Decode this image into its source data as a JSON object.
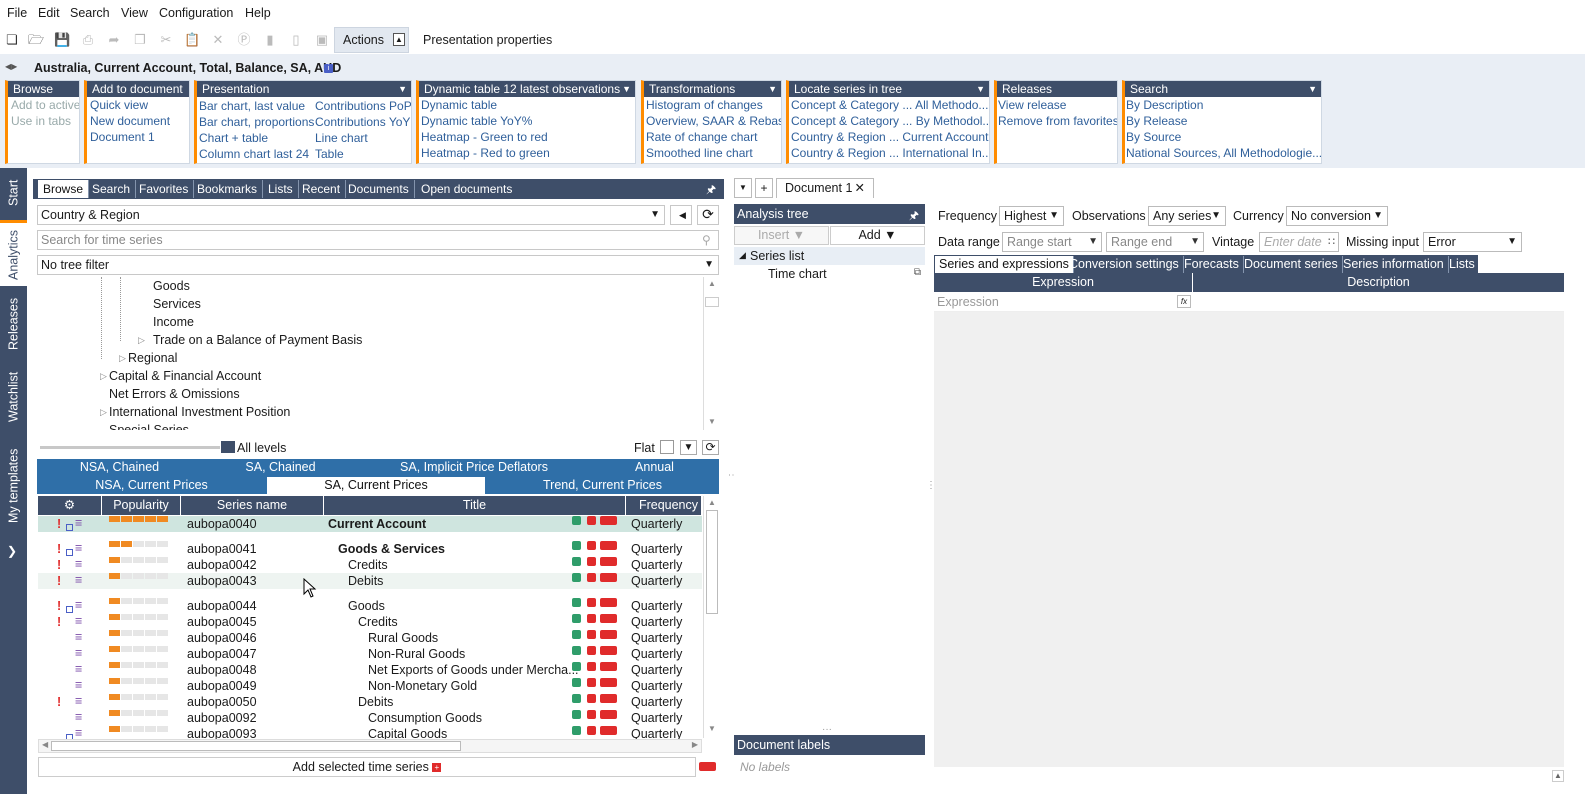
{
  "menu": [
    "File",
    "Edit",
    "Search",
    "View",
    "Configuration",
    "Help"
  ],
  "toolbar": {
    "actions_tab": "Actions",
    "presentation_tab": "Presentation properties"
  },
  "series_title": "Australia, Current Account, Total, Balance, SA, AUD",
  "ribbon": {
    "browse": {
      "title": "Browse",
      "items": [
        "Add to active",
        "Use in tabs"
      ]
    },
    "add_to_document": {
      "title": "Add to document",
      "items": [
        "Quick view",
        "New document",
        "Document 1"
      ]
    },
    "presentation": {
      "title": "Presentation",
      "col1": [
        "Bar chart, last value",
        "Bar chart, proportions",
        "Chart + table",
        "Column chart last 24"
      ],
      "col2": [
        "Contributions PoP",
        "Contributions YoY",
        "Line chart",
        "Table"
      ]
    },
    "dynamic_table": {
      "title": "Dynamic table 12 latest observations",
      "items": [
        "Dynamic table",
        "Dynamic table YoY%",
        "Heatmap - Green to red",
        "Heatmap - Red to green"
      ]
    },
    "transformations": {
      "title": "Transformations",
      "items": [
        "Histogram of changes",
        "Overview, SAAR & Rebase",
        "Rate of change chart",
        "Smoothed line chart"
      ]
    },
    "locate": {
      "title": "Locate series in tree",
      "items": [
        "Concept & Category ... All Methodo...",
        "Concept & Category ... By Methodol...",
        "Country & Region ... Current Account",
        "Country & Region ... International In..."
      ]
    },
    "releases": {
      "title": "Releases",
      "items": [
        "View release",
        "Remove from favorites"
      ]
    },
    "search": {
      "title": "Search",
      "items": [
        "By Description",
        "By Release",
        "By Source",
        "National Sources, All Methodologie..."
      ]
    }
  },
  "sidebar": [
    "Start",
    "Analytics",
    "Releases",
    "Watchlist",
    "My templates"
  ],
  "browse_tabs": [
    "Browse",
    "Search",
    "Favorites",
    "Bookmarks",
    "Lists",
    "Recent",
    "Documents",
    "Open documents"
  ],
  "tree_select": "Country & Region",
  "search_placeholder": "Search for time series",
  "tree_filter": "No tree filter",
  "tree": [
    {
      "label": "Goods",
      "indent": 2
    },
    {
      "label": "Services",
      "indent": 2
    },
    {
      "label": "Income",
      "indent": 2
    },
    {
      "label": "Trade on a Balance of Payment Basis",
      "indent": 2,
      "expand": true
    },
    {
      "label": "Regional",
      "indent": 1,
      "expand": true
    },
    {
      "label": "Capital & Financial Account",
      "indent": 0,
      "expand": true
    },
    {
      "label": "Net Errors & Omissions",
      "indent": 0
    },
    {
      "label": "International Investment Position",
      "indent": 0,
      "expand": true
    },
    {
      "label": "Special Series",
      "indent": 0
    }
  ],
  "levels": {
    "all_levels": "All levels",
    "flat": "Flat"
  },
  "cat_tabs_row1": [
    "NSA, Chained",
    "SA, Chained",
    "SA, Implicit Price Deflators",
    "Annual"
  ],
  "cat_tabs_row2": [
    "NSA, Current Prices",
    "SA, Current Prices",
    "Trend, Current Prices"
  ],
  "table_headers": [
    "Popularity",
    "Series name",
    "Title",
    "Frequency"
  ],
  "rows": [
    {
      "name": "aubopa0040",
      "title": "Current Account",
      "indent": 0,
      "bold": true,
      "freq": "Quarterly",
      "pop": 5,
      "excl": true,
      "sq": true
    },
    {
      "name": "aubopa0041",
      "title": "Goods & Services",
      "indent": 1,
      "bold": true,
      "freq": "Quarterly",
      "pop": 2,
      "excl": true,
      "sq": true
    },
    {
      "name": "aubopa0042",
      "title": "Credits",
      "indent": 2,
      "freq": "Quarterly",
      "pop": 1,
      "excl": true,
      "sq": false
    },
    {
      "name": "aubopa0043",
      "title": "Debits",
      "indent": 2,
      "freq": "Quarterly",
      "pop": 1,
      "excl": true,
      "sq": false
    },
    {
      "name": "aubopa0044",
      "title": "Goods",
      "indent": 2,
      "freq": "Quarterly",
      "pop": 1,
      "excl": true,
      "sq": true
    },
    {
      "name": "aubopa0045",
      "title": "Credits",
      "indent": 3,
      "freq": "Quarterly",
      "pop": 1,
      "excl": true,
      "sq": false
    },
    {
      "name": "aubopa0046",
      "title": "Rural Goods",
      "indent": 4,
      "freq": "Quarterly",
      "pop": 1,
      "excl": false,
      "sq": false
    },
    {
      "name": "aubopa0047",
      "title": "Non-Rural Goods",
      "indent": 4,
      "freq": "Quarterly",
      "pop": 1,
      "excl": false,
      "sq": false
    },
    {
      "name": "aubopa0048",
      "title": "Net Exports of Goods under Mercha...",
      "indent": 4,
      "freq": "Quarterly",
      "pop": 1,
      "excl": false,
      "sq": false
    },
    {
      "name": "aubopa0049",
      "title": "Non-Monetary Gold",
      "indent": 4,
      "freq": "Quarterly",
      "pop": 1,
      "excl": false,
      "sq": false
    },
    {
      "name": "aubopa0050",
      "title": "Debits",
      "indent": 3,
      "freq": "Quarterly",
      "pop": 1,
      "excl": true,
      "sq": false
    },
    {
      "name": "aubopa0092",
      "title": "Consumption Goods",
      "indent": 4,
      "freq": "Quarterly",
      "pop": 1,
      "excl": false,
      "sq": false
    },
    {
      "name": "aubopa0093",
      "title": "Capital Goods",
      "indent": 4,
      "freq": "Quarterly",
      "pop": 1,
      "excl": false,
      "sq": true
    }
  ],
  "add_selected": "Add selected time series",
  "doc_tab": "Document 1",
  "analysis": {
    "title": "Analysis tree",
    "insert": "Insert",
    "add": "Add",
    "series_list": "Series list",
    "time_chart": "Time chart",
    "doc_labels": "Document labels",
    "no_labels": "No labels"
  },
  "props": {
    "frequency_label": "Frequency",
    "frequency": "Highest",
    "observations_label": "Observations",
    "observations": "Any series",
    "currency_label": "Currency",
    "currency": "No conversion",
    "data_range_label": "Data range",
    "range_start": "Range start",
    "range_end": "Range end",
    "vintage_label": "Vintage",
    "vintage_placeholder": "Enter date",
    "missing_label": "Missing input",
    "missing": "Error"
  },
  "right_tabs": [
    "Series and expressions",
    "Conversion settings",
    "Forecasts",
    "Document series",
    "Series information",
    "Lists"
  ],
  "expr_headers": [
    "Expression",
    "Description"
  ],
  "expr_placeholder": "Expression",
  "colors": {
    "navy": "#3e4e69",
    "orange": "#ff8c00",
    "link": "#2f5f9a",
    "ribbon_bg": "#e9eef5"
  }
}
